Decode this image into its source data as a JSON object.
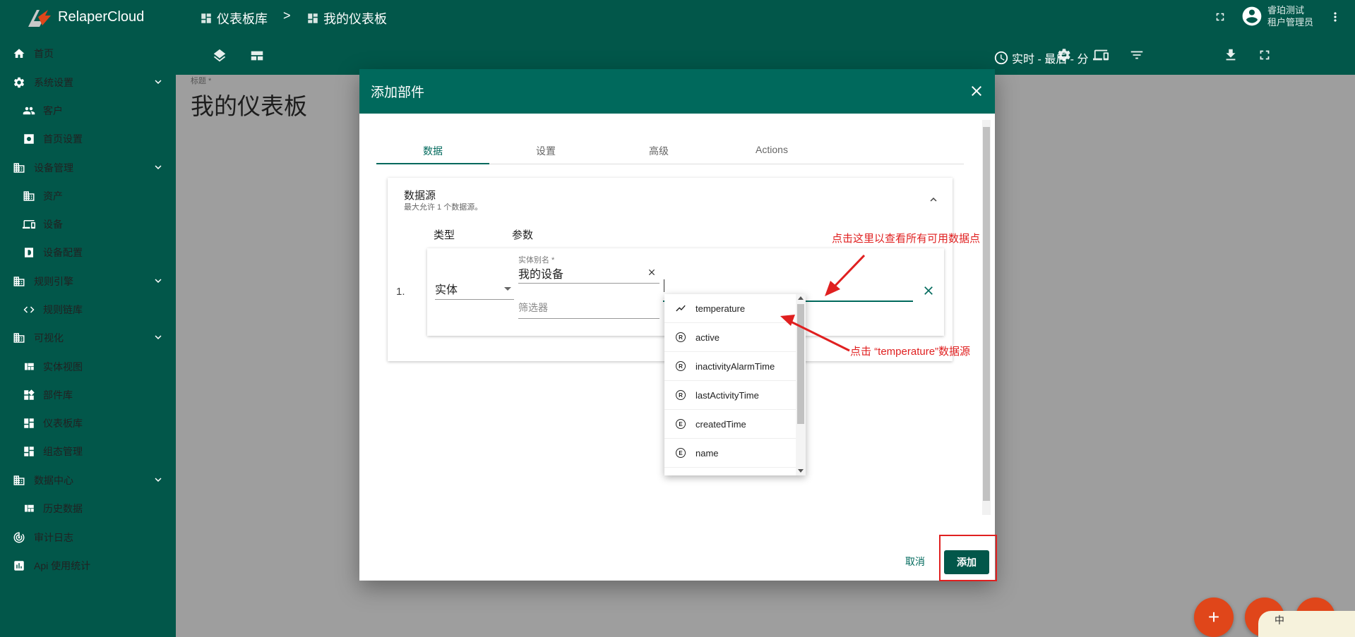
{
  "app": {
    "name": "RelaperCloud"
  },
  "breadcrumb": {
    "parent": "仪表板库",
    "separator": ">",
    "current": "我的仪表板"
  },
  "user": {
    "name": "睿珀测试",
    "role": "租户管理员"
  },
  "sidebar": {
    "items": [
      {
        "label": "首页",
        "icon": "home-icon"
      },
      {
        "label": "系统设置",
        "icon": "gear-icon",
        "expandable": true
      },
      {
        "label": "客户",
        "icon": "people-icon",
        "sub": true
      },
      {
        "label": "首页设置",
        "icon": "settings-box-icon",
        "sub": true
      },
      {
        "label": "设备管理",
        "icon": "building-icon",
        "expandable": true
      },
      {
        "label": "资产",
        "icon": "building-icon",
        "sub": true
      },
      {
        "label": "设备",
        "icon": "devices-icon",
        "sub": true
      },
      {
        "label": "设备配置",
        "icon": "device-profile-icon",
        "sub": true
      },
      {
        "label": "规则引擎",
        "icon": "building-icon",
        "expandable": true
      },
      {
        "label": "规则链库",
        "icon": "code-arrows-icon",
        "sub": true
      },
      {
        "label": "可视化",
        "icon": "building-icon",
        "expandable": true
      },
      {
        "label": "实体视图",
        "icon": "view-quilt-icon",
        "sub": true
      },
      {
        "label": "部件库",
        "icon": "widgets-icon",
        "sub": true
      },
      {
        "label": "仪表板库",
        "icon": "dashboard-icon",
        "sub": true
      },
      {
        "label": "组态管理",
        "icon": "dashboard-icon",
        "sub": true
      },
      {
        "label": "数据中心",
        "icon": "building-icon",
        "expandable": true
      },
      {
        "label": "历史数据",
        "icon": "view-quilt-icon",
        "sub": true
      },
      {
        "label": "审计日志",
        "icon": "track-changes-icon"
      },
      {
        "label": "Api 使用统计",
        "icon": "bar-chart-icon"
      }
    ]
  },
  "toolbar": {
    "timewindow": "实时 - 最后 - 分"
  },
  "dashboard": {
    "title_label": "标题 *",
    "title": "我的仪表板"
  },
  "dialog": {
    "title": "添加部件",
    "tabs": [
      "数据",
      "设置",
      "高级",
      "Actions"
    ],
    "datasource": {
      "title": "数据源",
      "subtitle": "最大允许 1 个数据源。",
      "col_type": "类型",
      "col_param": "参数",
      "row_index": "1.",
      "type_value": "实体",
      "alias_label": "实体别名 *",
      "alias_value": "我的设备",
      "filter_placeholder": "筛选器"
    },
    "dropdown": [
      {
        "label": "temperature",
        "icon": "timeseries-icon"
      },
      {
        "label": "active",
        "icon": "R"
      },
      {
        "label": "inactivityAlarmTime",
        "icon": "R"
      },
      {
        "label": "lastActivityTime",
        "icon": "R"
      },
      {
        "label": "createdTime",
        "icon": "E"
      },
      {
        "label": "name",
        "icon": "E"
      }
    ],
    "cancel_label": "取消",
    "add_label": "添加"
  },
  "annotations": {
    "hint_top": "点击这里以查看所有可用数据点",
    "hint_bottom": "点击 “temperature”数据源"
  },
  "ime": {
    "label": "中"
  },
  "colors": {
    "primary": "#02574a",
    "header": "#00695c",
    "accent": "#e0461a",
    "annotation": "#e02020"
  }
}
